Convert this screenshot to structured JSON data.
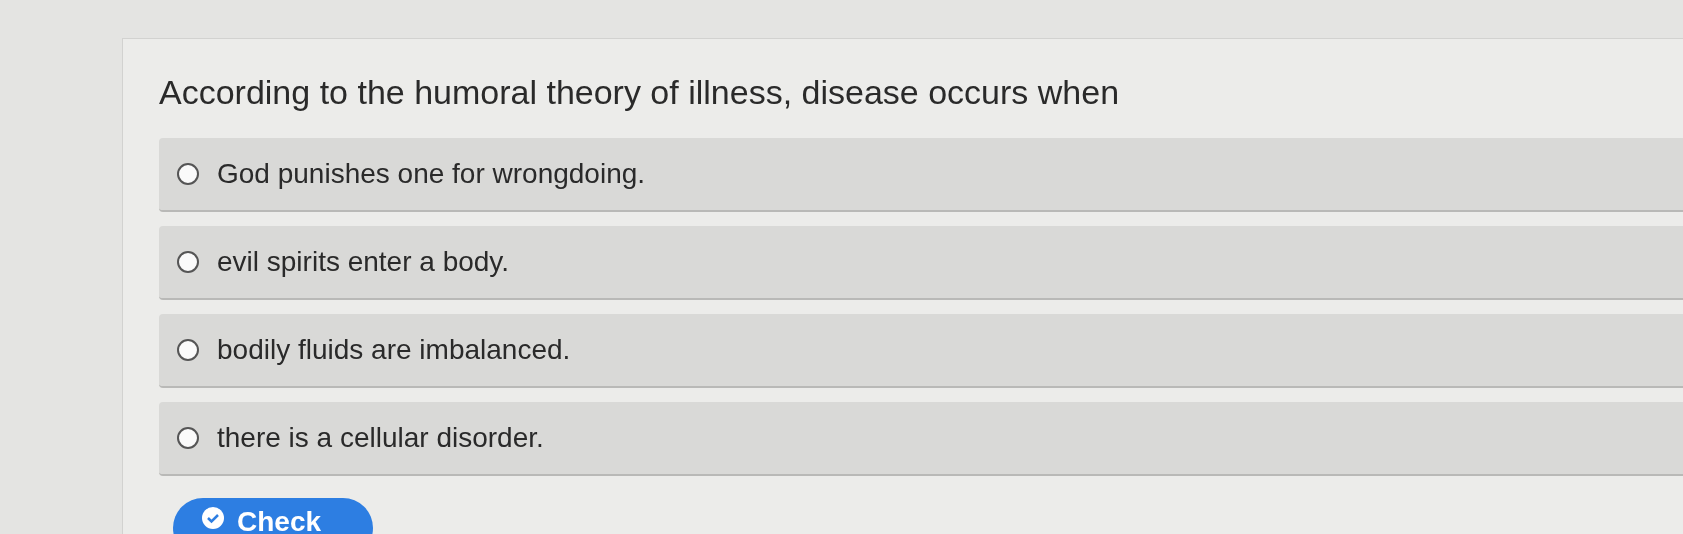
{
  "question": "According to the humoral theory of illness, disease occurs when",
  "options": [
    {
      "label": "God punishes one for wrongdoing.",
      "selected": false
    },
    {
      "label": "evil spirits enter a body.",
      "selected": false
    },
    {
      "label": "bodily fluids are imbalanced.",
      "selected": false
    },
    {
      "label": "there is a cellular disorder.",
      "selected": false
    }
  ],
  "check_button": {
    "label": "Check"
  }
}
